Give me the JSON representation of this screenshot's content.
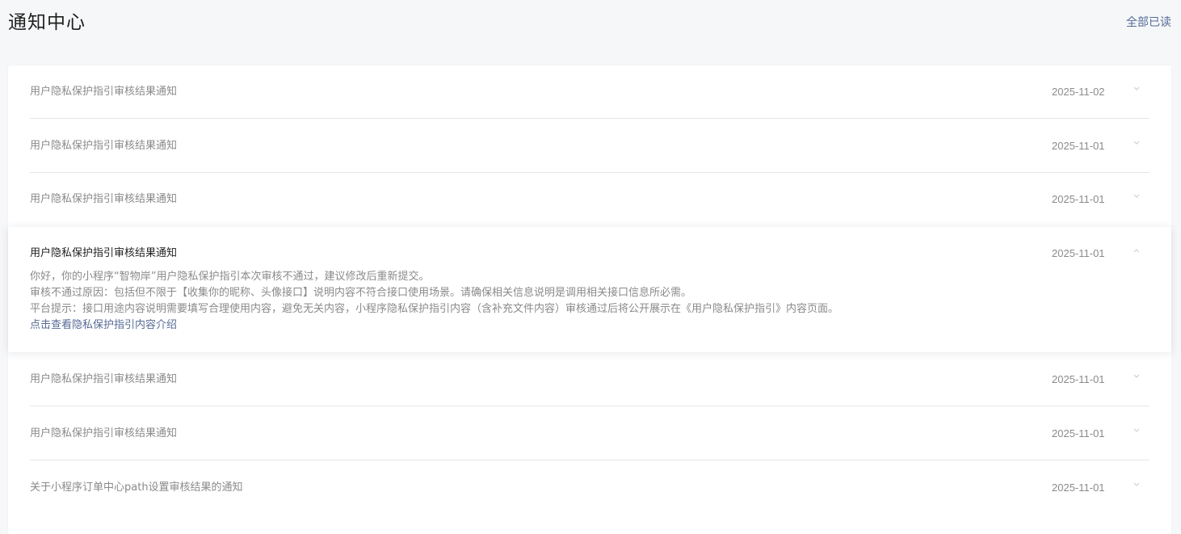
{
  "header": {
    "title": "通知中心",
    "mark_all_read": "全部已读"
  },
  "notifications": [
    {
      "title": "用户隐私保护指引审核结果通知",
      "date": "2025-11-02",
      "expanded": false
    },
    {
      "title": "用户隐私保护指引审核结果通知",
      "date": "2025-11-01",
      "expanded": false
    },
    {
      "title": "用户隐私保护指引审核结果通知",
      "date": "2025-11-01",
      "expanded": false
    },
    {
      "title": "用户隐私保护指引审核结果通知",
      "date": "2025-11-01",
      "expanded": true,
      "body": [
        "你好，你的小程序“智物岸”用户隐私保护指引本次审核不通过，建议修改后重新提交。",
        "审核不通过原因：包括但不限于【收集你的昵称、头像接口】说明内容不符合接口使用场景。请确保相关信息说明是调用相关接口信息所必需。",
        "平台提示：接口用途内容说明需要填写合理使用内容，避免无关内容，小程序隐私保护指引内容（含补充文件内容）审核通过后将公开展示在《用户隐私保护指引》内容页面。"
      ],
      "link": "点击查看隐私保护指引内容介绍"
    },
    {
      "title": "用户隐私保护指引审核结果通知",
      "date": "2025-11-01",
      "expanded": false
    },
    {
      "title": "用户隐私保护指引审核结果通知",
      "date": "2025-11-01",
      "expanded": false
    },
    {
      "title": "关于小程序订单中心path设置审核结果的通知",
      "date": "2025-11-01",
      "expanded": false
    }
  ],
  "icons": {
    "chevron_down": "chevron-down-icon",
    "chevron_up": "chevron-up-icon"
  },
  "colors": {
    "link": "#576b95",
    "muted_text": "#8a8a8a",
    "title_text": "#1f1f1f",
    "background": "#f6f7f9"
  }
}
